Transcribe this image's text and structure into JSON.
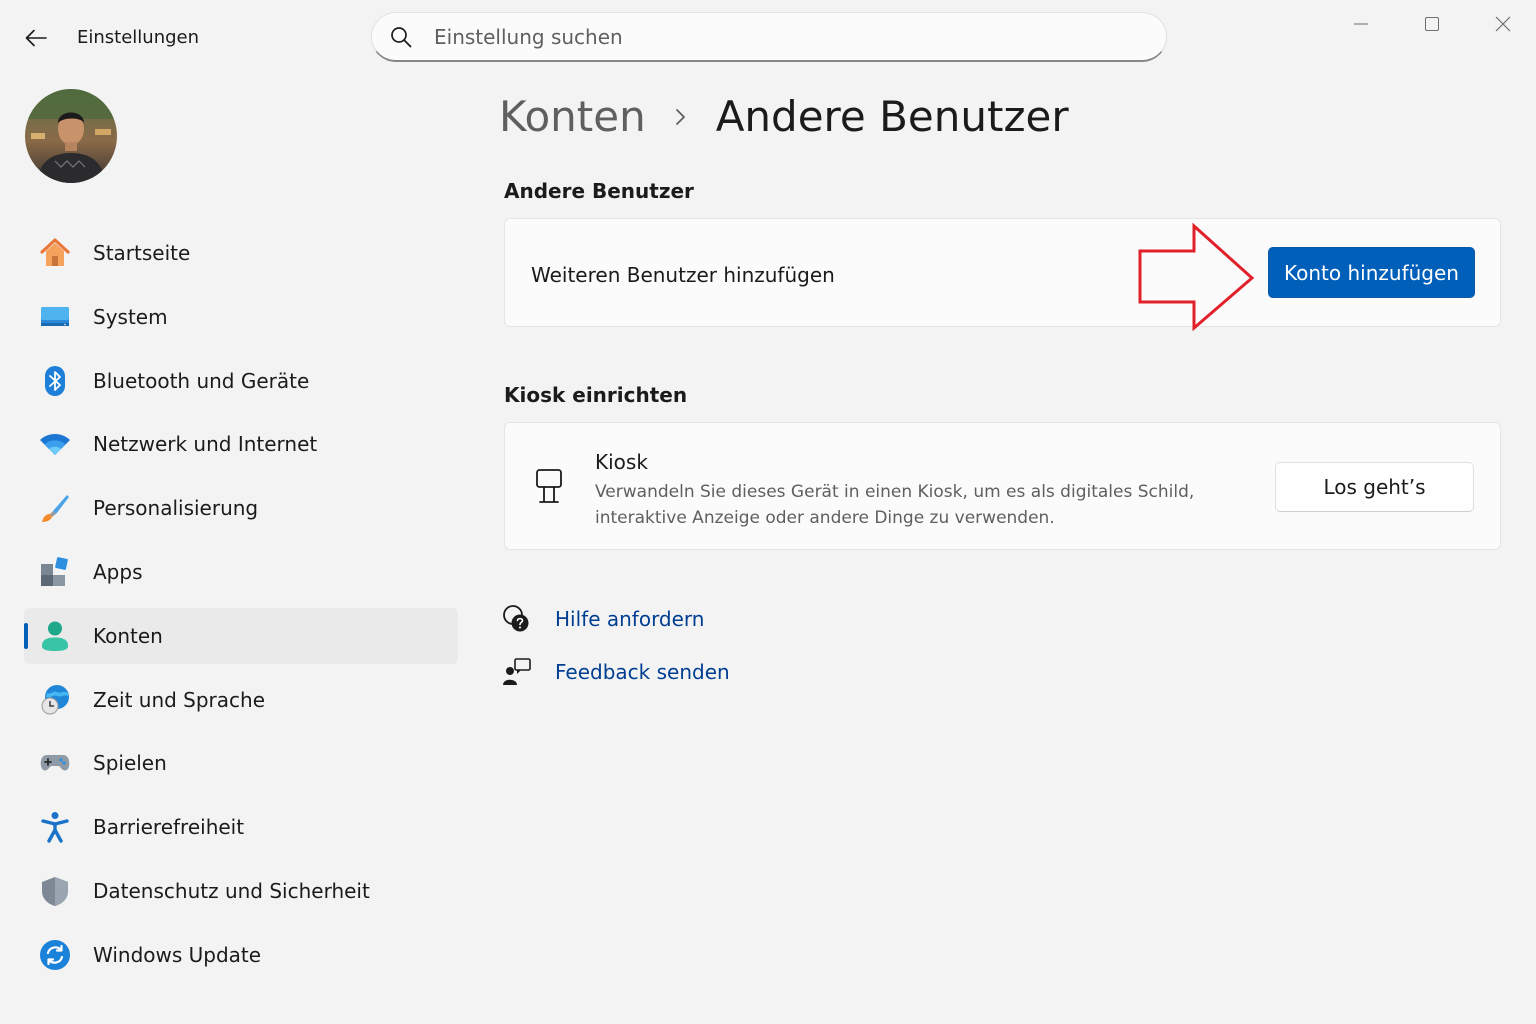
{
  "window": {
    "title": "Einstellungen",
    "controls": [
      "minimize-icon",
      "maximize-icon",
      "close-icon"
    ]
  },
  "search": {
    "placeholder": "Einstellung suchen",
    "value": ""
  },
  "sidebar": {
    "items": [
      {
        "label": "Startseite",
        "icon": "home-icon",
        "active": false
      },
      {
        "label": "System",
        "icon": "system-icon",
        "active": false
      },
      {
        "label": "Bluetooth und Geräte",
        "icon": "bluetooth-icon",
        "active": false
      },
      {
        "label": "Netzwerk und Internet",
        "icon": "wifi-icon",
        "active": false
      },
      {
        "label": "Personalisierung",
        "icon": "brush-icon",
        "active": false
      },
      {
        "label": "Apps",
        "icon": "apps-icon",
        "active": false
      },
      {
        "label": "Konten",
        "icon": "account-icon",
        "active": true
      },
      {
        "label": "Zeit und Sprache",
        "icon": "time-language-icon",
        "active": false
      },
      {
        "label": "Spielen",
        "icon": "gamepad-icon",
        "active": false
      },
      {
        "label": "Barrierefreiheit",
        "icon": "accessibility-icon",
        "active": false
      },
      {
        "label": "Datenschutz und Sicherheit",
        "icon": "shield-icon",
        "active": false
      },
      {
        "label": "Windows Update",
        "icon": "update-icon",
        "active": false
      }
    ]
  },
  "breadcrumb": {
    "parent": "Konten",
    "current": "Andere Benutzer"
  },
  "sections": {
    "other_users": {
      "title": "Andere Benutzer",
      "row_label": "Weiteren Benutzer hinzufügen",
      "button": "Konto hinzufügen"
    },
    "kiosk": {
      "title": "Kiosk einrichten",
      "item_title": "Kiosk",
      "item_description": "Verwandeln Sie dieses Gerät in einen Kiosk, um es als digitales Schild, interaktive Anzeige oder andere Dinge zu verwenden.",
      "button": "Los geht’s"
    }
  },
  "links": {
    "help": "Hilfe anfordern",
    "feedback": "Feedback senden"
  },
  "colors": {
    "accent": "#005fb8",
    "link": "#003e92",
    "annotation_arrow": "#e1202a",
    "background": "#f3f3f3",
    "card": "#fbfbfb"
  }
}
